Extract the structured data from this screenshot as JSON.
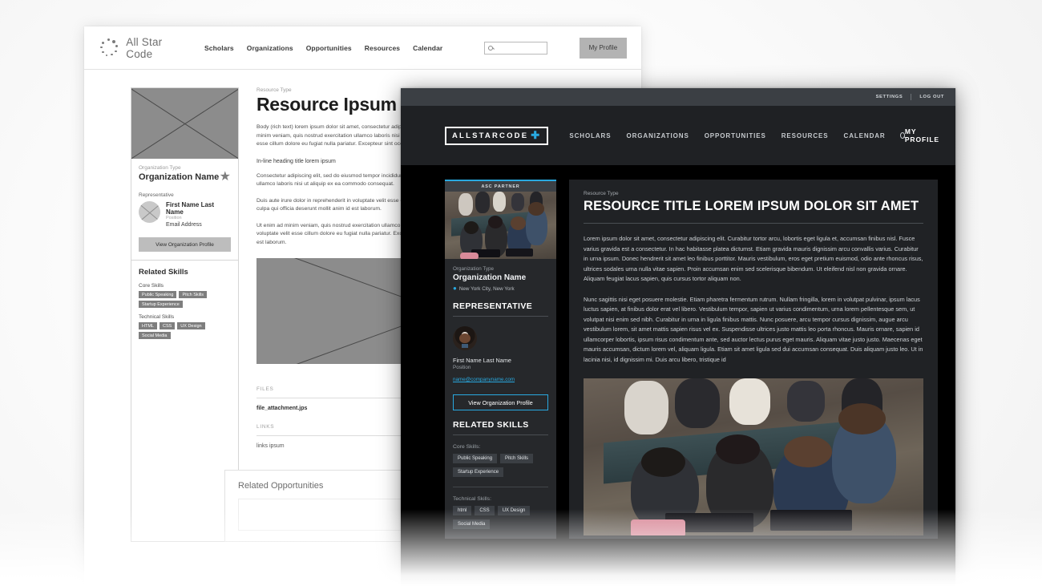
{
  "wireframe": {
    "nav": {
      "logo_text": "All Star Code",
      "logo_icon": "dot-circle-logo-icon",
      "links": [
        "Scholars",
        "Organizations",
        "Opportunities",
        "Resources",
        "Calendar"
      ],
      "search_placeholder": "",
      "search_icon": "search-icon",
      "profile_label": "My Profile"
    },
    "sidebar": {
      "image_placeholder": "image-placeholder",
      "org_type": "Organization Type",
      "org_name": "Organization Name",
      "star_icon": "star-icon",
      "representative_label": "Representative",
      "rep_name": "First Name Last Name",
      "rep_position": "Position",
      "rep_email": "Email Address",
      "button_label": "View Organization Profile",
      "skills_heading": "Related Skills",
      "core_label": "Core Skills",
      "core_tags": [
        "Public Speaking",
        "Pitch Skills",
        "Startup Experience"
      ],
      "technical_label": "Technical Skills",
      "technical_tags": [
        "HTML",
        "CSS",
        "UX Design",
        "Social Media"
      ]
    },
    "main": {
      "resource_type": "Resource Type",
      "title": "Resource Ipsum",
      "body_intro": "Body (rich text) lorem ipsum dolor sit amet, consectetur adipiscing elit, sed do eiusmod tempor incididunt ut labore et dolore magna aliqua. Ut enim ad minim veniam, quis nostrud exercitation ullamco laboris nisi ut aliquip ex ea commodo consequat. Duis aute irure dolor in reprehenderit in voluptate velit esse cillum dolore eu fugiat nulla pariatur. Excepteur sint occaecat cupidatat non proident, sunt in culpa qui officia.",
      "inline_heading": "In-line heading title lorem ipsum",
      "para_1": "Consectetur adipiscing elit, sed do eiusmod tempor incididunt ut labore et dolore magna aliqua. Ut enim ad minim veniam, quis nostrud exercitation ullamco laboris nisi ut aliquip ex ea commodo consequat.",
      "para_2": "Duis aute irure dolor in reprehenderit in voluptate velit esse cillum dolore eu fugiat nulla pariatur. Excepteur sint occaecat cupidatat non proident, sunt in culpa qui officia deserunt mollit anim id est laborum.",
      "para_3": "Ut enim ad minim veniam, quis nostrud exercitation ullamco laboris nisi ut aliquip ex ea commodo consequat. Duis aute irure dolor in reprehenderit in voluptate velit esse cillum dolore eu fugiat nulla pariatur. Excepteur sint occaecat cupidatat non proident, sunt in culpa qui officia deserunt mollit anim id est laborum.",
      "files_label": "FILES",
      "file_item": "file_attachment.jps",
      "links_label": "LINKS",
      "link_item": "links ipsum",
      "related_heading": "Related Opportunities"
    }
  },
  "dark": {
    "utility": {
      "settings": "SETTINGS",
      "logout": "LOG OUT"
    },
    "nav": {
      "logo_text": "ALLSTARCODE",
      "logo_plus_icon": "plus-icon",
      "links": [
        "SCHOLARS",
        "ORGANIZATIONS",
        "OPPORTUNITIES",
        "RESOURCES",
        "CALENDAR"
      ],
      "search_icon": "search-icon",
      "profile_label": "MY PROFILE",
      "accent_color": "#29a9e0"
    },
    "sidebar": {
      "badge": "ASC PARTNER",
      "photo_alt": "students-collaborating-photo",
      "org_type": "Organization Type",
      "org_name": "Organization Name",
      "location_icon": "map-pin-icon",
      "location": "New York City, New York",
      "representative_heading": "REPRESENTATIVE",
      "rep_avatar": "representative-avatar",
      "rep_name": "First Name Last Name",
      "rep_position": "Position",
      "rep_email": "name@companyname.com",
      "button_label": "View Organization Profile",
      "skills_heading": "RELATED SKILLS",
      "core_label": "Core Skills:",
      "core_tags": [
        "Public Speaking",
        "Pitch Skills",
        "Startup Experience"
      ],
      "technical_label": "Technical Skills:",
      "technical_tags": [
        "html",
        "CSS",
        "UX Design",
        "Social Media"
      ]
    },
    "main": {
      "resource_type": "Resource Type",
      "title": "RESOURCE TITLE LOREM IPSUM DOLOR SIT AMET",
      "para_1": "Lorem ipsum dolor sit amet, consectetur adipiscing elit. Curabitur tortor arcu, lobortis eget ligula et, accumsan finibus nisl. Fusce varius gravida est a consectetur. In hac habitasse platea dictumst. Etiam gravida mauris dignissim arcu convallis varius. Curabitur in urna ipsum. Donec hendrerit sit amet leo finibus porttitor. Mauris vestibulum, eros eget pretium euismod, odio ante rhoncus risus, ultrices sodales urna nulla vitae sapien. Proin accumsan enim sed scelerisque bibendum. Ut eleifend nisl non gravida ornare. Aliquam feugiat lacus sapien, quis cursus tortor aliquam non.",
      "para_2": "Nunc sagittis nisi eget posuere molestie. Etiam pharetra fermentum rutrum. Nullam fringilla, lorem in volutpat pulvinar, ipsum lacus luctus sapien, at finibus dolor erat vel libero. Vestibulum tempor, sapien ut varius condimentum, urna lorem pellentesque sem, ut volutpat nisi enim sed nibh. Curabitur in urna in ligula finibus mattis. Nunc posuere, arcu tempor cursus dignissim, augue arcu vestibulum lorem, sit amet mattis sapien risus vel ex. Suspendisse ultrices justo mattis leo porta rhoncus. Mauris ornare, sapien id ullamcorper lobortis, ipsum risus condimentum ante, sed auctor lectus purus eget mauris. Aliquam vitae justo justo. Maecenas eget mauris accumsan, dictum lorem vel, aliquam ligula. Etiam sit amet ligula sed dui accumsan consequat. Duis aliquam justo leo. Ut in lacinia nisi, id dignissim mi. Duis arcu libero, tristique id",
      "photo_alt": "students-workshop-photo"
    }
  }
}
